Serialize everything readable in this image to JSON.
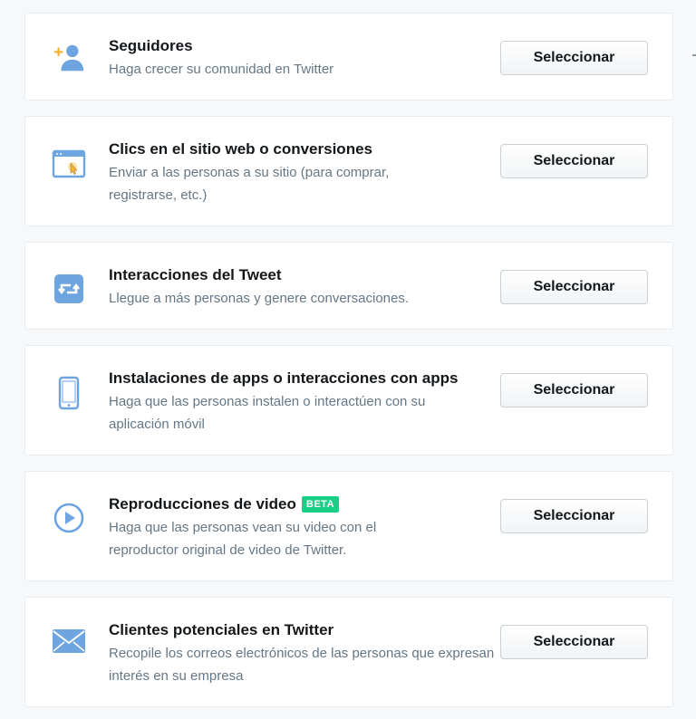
{
  "objectives": [
    {
      "title": "Seguidores",
      "description": "Haga crecer su comunidad en Twitter",
      "button": "Seleccionar",
      "icon": "add-follower-icon"
    },
    {
      "title": "Clics en el sitio web o conversiones",
      "description": "Enviar a las personas a su sitio (para comprar, registrarse, etc.)",
      "button": "Seleccionar",
      "icon": "website-click-icon"
    },
    {
      "title": "Interacciones del Tweet",
      "description": "Llegue a más personas y genere conversaciones.",
      "button": "Seleccionar",
      "icon": "retweet-icon"
    },
    {
      "title": "Instalaciones de apps o interacciones con apps",
      "description": "Haga que las personas instalen o interactúen con su aplicación móvil",
      "button": "Seleccionar",
      "icon": "mobile-phone-icon"
    },
    {
      "title": "Reproducciones de video",
      "badge": "BETA",
      "description": "Haga que las personas vean su video con el reproductor original de video de Twitter.",
      "button": "Seleccionar",
      "icon": "play-icon"
    },
    {
      "title": "Clientes potenciales en Twitter",
      "description": "Recopile los correos electrónicos de las personas que expresan interés en su empresa",
      "button": "Seleccionar",
      "icon": "envelope-icon"
    }
  ],
  "colors": {
    "icon_blue": "#6ea5e0",
    "icon_accent": "#f5b338",
    "badge_green": "#19cf86"
  }
}
